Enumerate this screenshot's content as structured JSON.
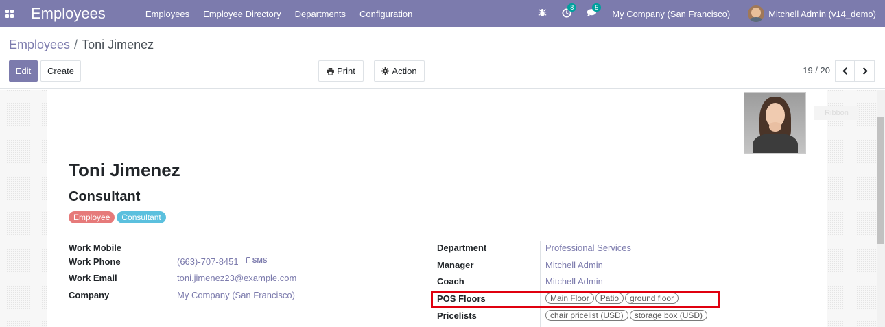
{
  "navbar": {
    "app_title": "Employees",
    "menu": [
      "Employees",
      "Employee Directory",
      "Departments",
      "Configuration"
    ],
    "activity_count": "8",
    "message_count": "5",
    "company": "My Company (San Francisco)",
    "user": "Mitchell Admin (v14_demo)",
    "color": "#7c7bad"
  },
  "breadcrumb": {
    "parent": "Employees",
    "current": "Toni Jimenez"
  },
  "toolbar": {
    "edit": "Edit",
    "create": "Create",
    "print": "Print",
    "action": "Action"
  },
  "pager": {
    "value": "19 / 20"
  },
  "ribbon": "Ribbon",
  "employee": {
    "name": "Toni Jimenez",
    "job_title": "Consultant",
    "tags": [
      {
        "label": "Employee",
        "color": "#e67a7a"
      },
      {
        "label": "Consultant",
        "color": "#5bc0de"
      }
    ]
  },
  "left_fields": {
    "work_mobile_label": "Work Mobile",
    "work_phone_label": "Work Phone",
    "work_phone": "(663)-707-8451",
    "sms": "SMS",
    "work_email_label": "Work Email",
    "work_email": "toni.jimenez23@example.com",
    "company_label": "Company",
    "company": "My Company (San Francisco)"
  },
  "right_fields": {
    "department_label": "Department",
    "department": "Professional Services",
    "manager_label": "Manager",
    "manager": "Mitchell Admin",
    "coach_label": "Coach",
    "coach": "Mitchell Admin",
    "pos_floors_label": "POS Floors",
    "pos_floors": [
      "Main Floor",
      "Patio",
      "ground floor"
    ],
    "pricelists_label": "Pricelists",
    "pricelists": [
      "chair pricelist (USD)",
      "storage box (USD)"
    ]
  },
  "highlight_color": "#e0000f"
}
